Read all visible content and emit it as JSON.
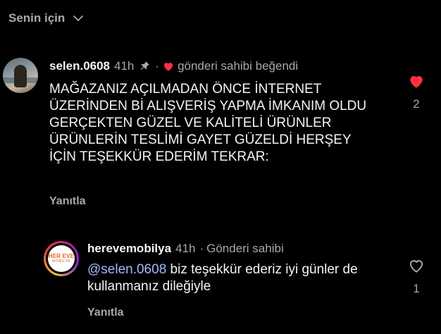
{
  "sort": {
    "label": "Senin için"
  },
  "comments": [
    {
      "username": "selen.0608",
      "time": "41h",
      "author_liked": "gönderi sahibi beğendi",
      "text": "MAĞAZANIZ AÇILMADAN ÖNCE İNTERNET ÜZERİNDEN Bİ ALIŞVERİŞ YAPMA İMKANIM OLDU GERÇEKTEN GÜZEL VE KALİTELİ ÜRÜNLER ÜRÜNLERİN TESLİMİ GAYET GÜZELDİ HERŞEY İÇİN TEŞEKKÜR EDERİM TEKRAR:",
      "reply_label": "Yanıtla",
      "like_count": "2",
      "liked": true
    },
    {
      "username": "herevemobilya",
      "time": "41h",
      "author_label": "Gönderi sahibi",
      "avatar_logo_line1": "HER EVE",
      "avatar_logo_line2": "MOBİLYA",
      "mention": "@selen.0608",
      "text": " biz teşekkür ederiz iyi günler de kullanmanız dileğiyle",
      "reply_label": "Yanıtla",
      "like_count": "1",
      "liked": false
    }
  ],
  "colors": {
    "heart": "#ff3040",
    "muted": "#a8a8a8",
    "mention": "#a5b8fb"
  }
}
